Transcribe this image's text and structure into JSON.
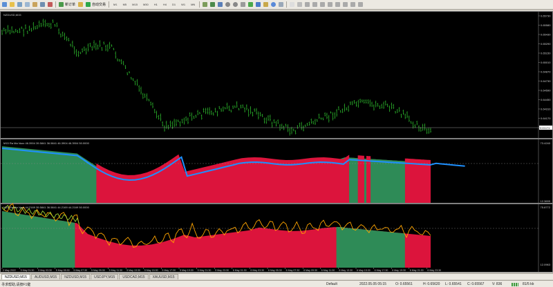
{
  "toolbar": {
    "new_order_label": "新订单",
    "autotrading_label": "自动交易",
    "timeframes": [
      "M1",
      "M5",
      "M15",
      "M30",
      "H1",
      "H4",
      "D1",
      "W1",
      "MN"
    ]
  },
  "main_chart": {
    "symbol_label": "NZDUSD,M15",
    "current_price": "0.64471",
    "price_ticks": [
      "0.65730",
      "0.65580",
      "0.65430",
      "0.65290",
      "0.65150",
      "0.65010",
      "0.64870",
      "0.64730",
      "0.64590",
      "0.64450",
      "0.64310",
      "0.64170",
      "0.64000"
    ]
  },
  "indicator1": {
    "label": "M15 Ra Ma Vazz 46.3904 39.5841 36.5841 46.3904 46.3904 50.0000",
    "top_tick": "73.4240",
    "bottom_tick": "12.3699"
  },
  "indicator2": {
    "label": "M15 Ra Ma Vazz 44.2169 39.5841 36.5841 44.2169 44.2169 50.0000",
    "top_tick": "75.8772",
    "bottom_tick": "12.0963"
  },
  "time_axis": [
    "2 May 2022",
    "5 May 01:30",
    "5 May 03:30",
    "5 May 05:30",
    "5 May 07:30",
    "5 May 09:30",
    "5 May 11:30",
    "5 May 13:30",
    "5 May 15:30",
    "5 May 17:30",
    "5 May 19:30",
    "5 May 21:30",
    "5 May 23:30",
    "6 May 01:30",
    "6 May 03:30",
    "6 May 05:30",
    "6 May 07:30",
    "6 May 09:30",
    "6 May 11:30",
    "6 May 13:30",
    "6 May 15:30",
    "6 May 17:30",
    "6 May 19:30",
    "6 May 21:30",
    "6 May 23:30"
  ],
  "tabs": [
    "NZDUSD,M15",
    "AUDUSD,M15",
    "NZDUSD,M15",
    "USDJPY,M15",
    "USDCAD,M15",
    "XAUUSD,M15"
  ],
  "status": {
    "help": "寻求帮助,请按F1键",
    "profile": "Default",
    "datetime": "2022.05.05 05:15",
    "open": "O: 0.65561",
    "high": "H: 0.65620",
    "low": "L: 0.65541",
    "close": "C: 0.65567",
    "volume": "V: 836",
    "traffic": "81/5 kb"
  },
  "colors": {
    "bull": "#2e8b57",
    "bear": "#dc143c",
    "candle": "#32cd32",
    "ma_line": "#1e90ff",
    "osc_line": "#9acd32",
    "osc_line2": "#ffa500"
  }
}
